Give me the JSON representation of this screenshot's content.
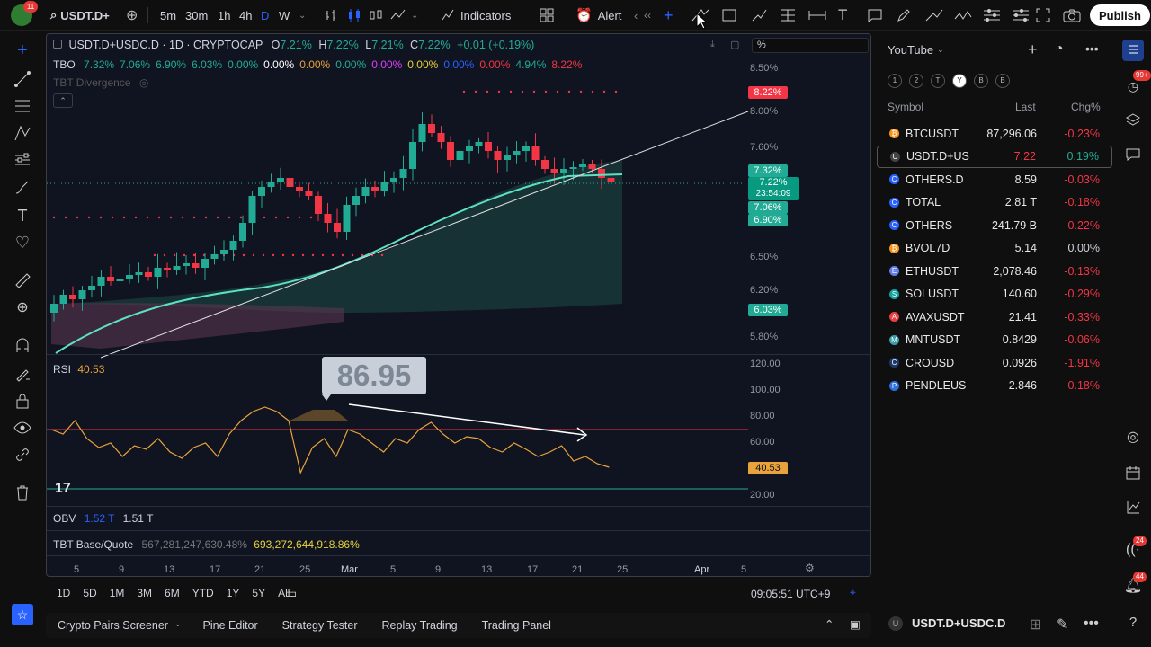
{
  "toolbar": {
    "symbol": "USDT.D+",
    "intervals": [
      "5m",
      "30m",
      "1h",
      "4h",
      "D",
      "W"
    ],
    "active_interval": "D",
    "indicators_label": "Indicators",
    "alert_label": "Alert",
    "publish_label": "Publish",
    "avatar_badge": "11"
  },
  "chart": {
    "title": "USDT.D+USDC.D · 1D · CRYPTOCAP",
    "ohlc": {
      "o_label": "O",
      "o": "7.21%",
      "h_label": "H",
      "h": "7.22%",
      "l_label": "L",
      "l": "7.21%",
      "c_label": "C",
      "c": "7.22%",
      "change": "+0.01 (+0.19%)"
    },
    "tbo": {
      "label": "TBO",
      "values": [
        "7.32%",
        "7.06%",
        "6.90%",
        "6.03%",
        "0.00%",
        "0.00%",
        "0.00%",
        "0.00%",
        "0.00%",
        "0.00%",
        "0.00%",
        "0.00%",
        "4.94%",
        "8.22%"
      ]
    },
    "tbt_divergence": "TBT Divergence",
    "price_scale": [
      "8.50%",
      "8.00%",
      "7.60%",
      "6.50%",
      "6.20%",
      "5.80%"
    ],
    "price_tags": [
      {
        "text": "8.22%",
        "color": "#f23645"
      },
      {
        "text": "7.32%",
        "color": "#089981"
      },
      {
        "text": "7.22%",
        "color": "#089981"
      },
      {
        "text": "23:54:09",
        "color": "#089981"
      },
      {
        "text": "7.06%",
        "color": "#089981"
      },
      {
        "text": "6.90%",
        "color": "#089981"
      },
      {
        "text": "6.03%",
        "color": "#089981"
      }
    ],
    "scale_input": "%",
    "annotation": "86.95",
    "rsi": {
      "label": "RSI",
      "value": "40.53",
      "scale": [
        "120.00",
        "100.00",
        "80.00",
        "60.00",
        "20.00"
      ],
      "tag": "40.53"
    },
    "obv": {
      "label": "OBV",
      "v1": "1.52 T",
      "v2": "1.51 T"
    },
    "tbt_base": {
      "label": "TBT Base/Quote",
      "v1": "567,281,247,630.48%",
      "v2": "693,272,644,918.86%"
    },
    "dates": [
      "5",
      "9",
      "13",
      "17",
      "21",
      "25",
      "Mar",
      "5",
      "9",
      "13",
      "17",
      "21",
      "25",
      "Apr",
      "5"
    ]
  },
  "ranges": [
    "1D",
    "5D",
    "1M",
    "3M",
    "6M",
    "YTD",
    "1Y",
    "5Y",
    "All"
  ],
  "clock": "09:05:51 UTC+9",
  "footer_tabs": [
    "Crypto Pairs Screener",
    "Pine Editor",
    "Strategy Tester",
    "Replay Trading",
    "Trading Panel"
  ],
  "watchlist": {
    "title": "YouTube",
    "filters": [
      "1",
      "2",
      "T",
      "Y",
      "B",
      "B"
    ],
    "headers": {
      "symbol": "Symbol",
      "last": "Last",
      "chg": "Chg%"
    },
    "rows": [
      {
        "sym": "BTCUSDT",
        "last": "87,296.06",
        "chg": "-0.23%",
        "color": "#f7931a",
        "icon": "₿"
      },
      {
        "sym": "USDT.D+US",
        "last": "7.22",
        "chg": "0.19%",
        "color": "#444",
        "icon": "U"
      },
      {
        "sym": "OTHERS.D",
        "last": "8.59",
        "chg": "-0.03%",
        "color": "#2962ff",
        "icon": "C"
      },
      {
        "sym": "TOTAL",
        "last": "2.81 T",
        "chg": "-0.18%",
        "color": "#2962ff",
        "icon": "C"
      },
      {
        "sym": "OTHERS",
        "last": "241.79 B",
        "chg": "-0.22%",
        "color": "#2962ff",
        "icon": "C"
      },
      {
        "sym": "BVOL7D",
        "last": "5.14",
        "chg": "0.00%",
        "color": "#f7931a",
        "icon": "₿"
      },
      {
        "sym": "ETHUSDT",
        "last": "2,078.46",
        "chg": "-0.13%",
        "color": "#627eea",
        "icon": "E"
      },
      {
        "sym": "SOLUSDT",
        "last": "140.60",
        "chg": "-0.29%",
        "color": "#14a0a0",
        "icon": "S"
      },
      {
        "sym": "AVAXUSDT",
        "last": "21.41",
        "chg": "-0.33%",
        "color": "#e84142",
        "icon": "A"
      },
      {
        "sym": "MNTUSDT",
        "last": "0.8429",
        "chg": "-0.06%",
        "color": "#3a9ca8",
        "icon": "M"
      },
      {
        "sym": "CROUSD",
        "last": "0.0926",
        "chg": "-1.91%",
        "color": "#1b3a6b",
        "icon": "C"
      },
      {
        "sym": "PENDLEUS",
        "last": "2.846",
        "chg": "-0.18%",
        "color": "#2f6fe0",
        "icon": "P"
      }
    ]
  },
  "right_badges": {
    "notif": "99+",
    "b1": "24",
    "b2": "44"
  },
  "footer_symbol": "USDT.D+USDC.D",
  "colors": {
    "up": "#22ab94",
    "down": "#f23645",
    "ema": "#5ce1c3",
    "rsi": "#e8a33d"
  }
}
